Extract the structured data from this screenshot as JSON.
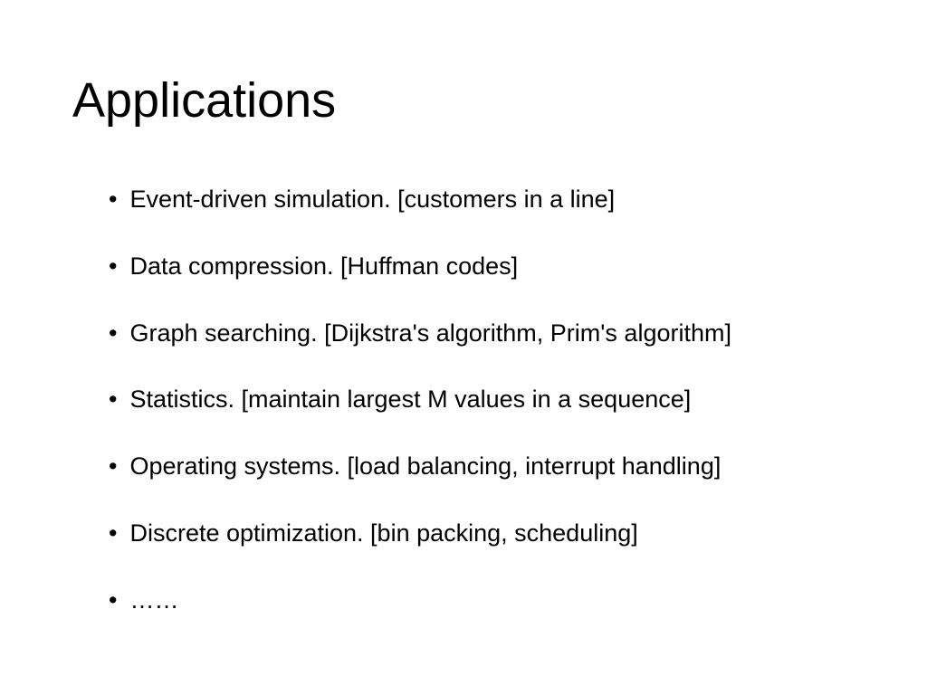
{
  "slide": {
    "title": "Applications",
    "bullets": [
      "Event-driven simulation.  [customers in a line]",
      "Data compression.           [Huffman codes]",
      "Graph searching. [Dijkstra's algorithm, Prim's algorithm]",
      "Statistics.  [maintain largest M values in a sequence]",
      "Operating systems. [load balancing, interrupt handling]",
      "Discrete optimization.      [bin packing, scheduling]",
      "……"
    ],
    "bullet_marker": "•"
  }
}
